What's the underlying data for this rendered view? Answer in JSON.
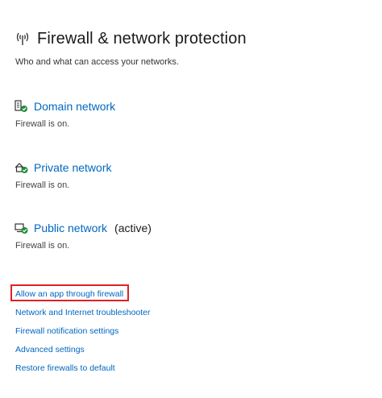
{
  "header": {
    "title": "Firewall & network protection",
    "subtitle": "Who and what can access your networks.",
    "icon": "firewall-antenna-icon"
  },
  "networks": [
    {
      "label": "Domain network",
      "status": "Firewall is on.",
      "active": "",
      "icon": "domain-network-icon"
    },
    {
      "label": "Private network",
      "status": "Firewall is on.",
      "active": "",
      "icon": "private-network-icon"
    },
    {
      "label": "Public network",
      "status": "Firewall is on.",
      "active": "(active)",
      "icon": "public-network-icon"
    }
  ],
  "links": [
    "Allow an app through firewall",
    "Network and Internet troubleshooter",
    "Firewall notification settings",
    "Advanced settings",
    "Restore firewalls to default"
  ],
  "colors": {
    "link": "#0067c0",
    "highlight": "#e02128",
    "check": "#1e8a3a"
  }
}
